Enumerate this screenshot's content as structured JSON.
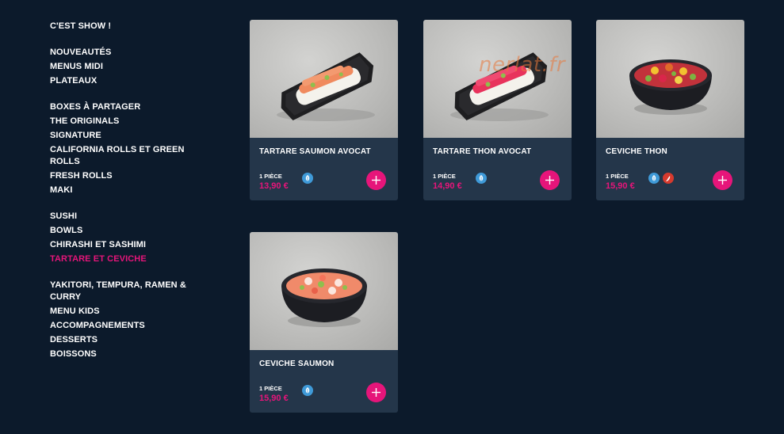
{
  "sidebar": {
    "groups": [
      [
        "C'EST SHOW !"
      ],
      [
        "NOUVEAUTÉS",
        "MENUS MIDI",
        "PLATEAUX"
      ],
      [
        "BOXES À PARTAGER",
        "THE ORIGINALS",
        "SIGNATURE",
        "CALIFORNIA ROLLS ET GREEN ROLLS",
        "FRESH ROLLS",
        "MAKI"
      ],
      [
        "SUSHI",
        "BOWLS",
        "CHIRASHI ET SASHIMI",
        "TARTARE ET CEVICHE"
      ],
      [
        "YAKITORI, TEMPURA, RAMEN & CURRY",
        "MENU KIDS",
        "ACCOMPAGNEMENTS",
        "DESSERTS",
        "BOISSONS"
      ]
    ],
    "active": "TARTARE ET CEVICHE"
  },
  "products": [
    {
      "name": "TARTARE SAUMON AVOCAT",
      "qty": "1 PIÈCE",
      "price": "13,90 €",
      "badges": [
        "leaf-icon"
      ],
      "image": "tartare-saumon"
    },
    {
      "name": "TARTARE THON AVOCAT",
      "qty": "1 PIÈCE",
      "price": "14,90 €",
      "badges": [
        "leaf-icon"
      ],
      "image": "tartare-thon",
      "watermark": "nerlat.fr"
    },
    {
      "name": "CEVICHE THON",
      "qty": "1 PIÈCE",
      "price": "15,90 €",
      "badges": [
        "leaf-icon",
        "chili-icon"
      ],
      "image": "ceviche-thon"
    },
    {
      "name": "CEVICHE SAUMON",
      "qty": "1 PIÈCE",
      "price": "15,90 €",
      "badges": [
        "leaf-icon"
      ],
      "image": "ceviche-saumon"
    }
  ],
  "colors": {
    "background": "#0c1a2b",
    "card": "#24364a",
    "accent": "#e6157a",
    "leaf_badge": "#3f9ad8",
    "chili_badge": "#d63a2e"
  }
}
